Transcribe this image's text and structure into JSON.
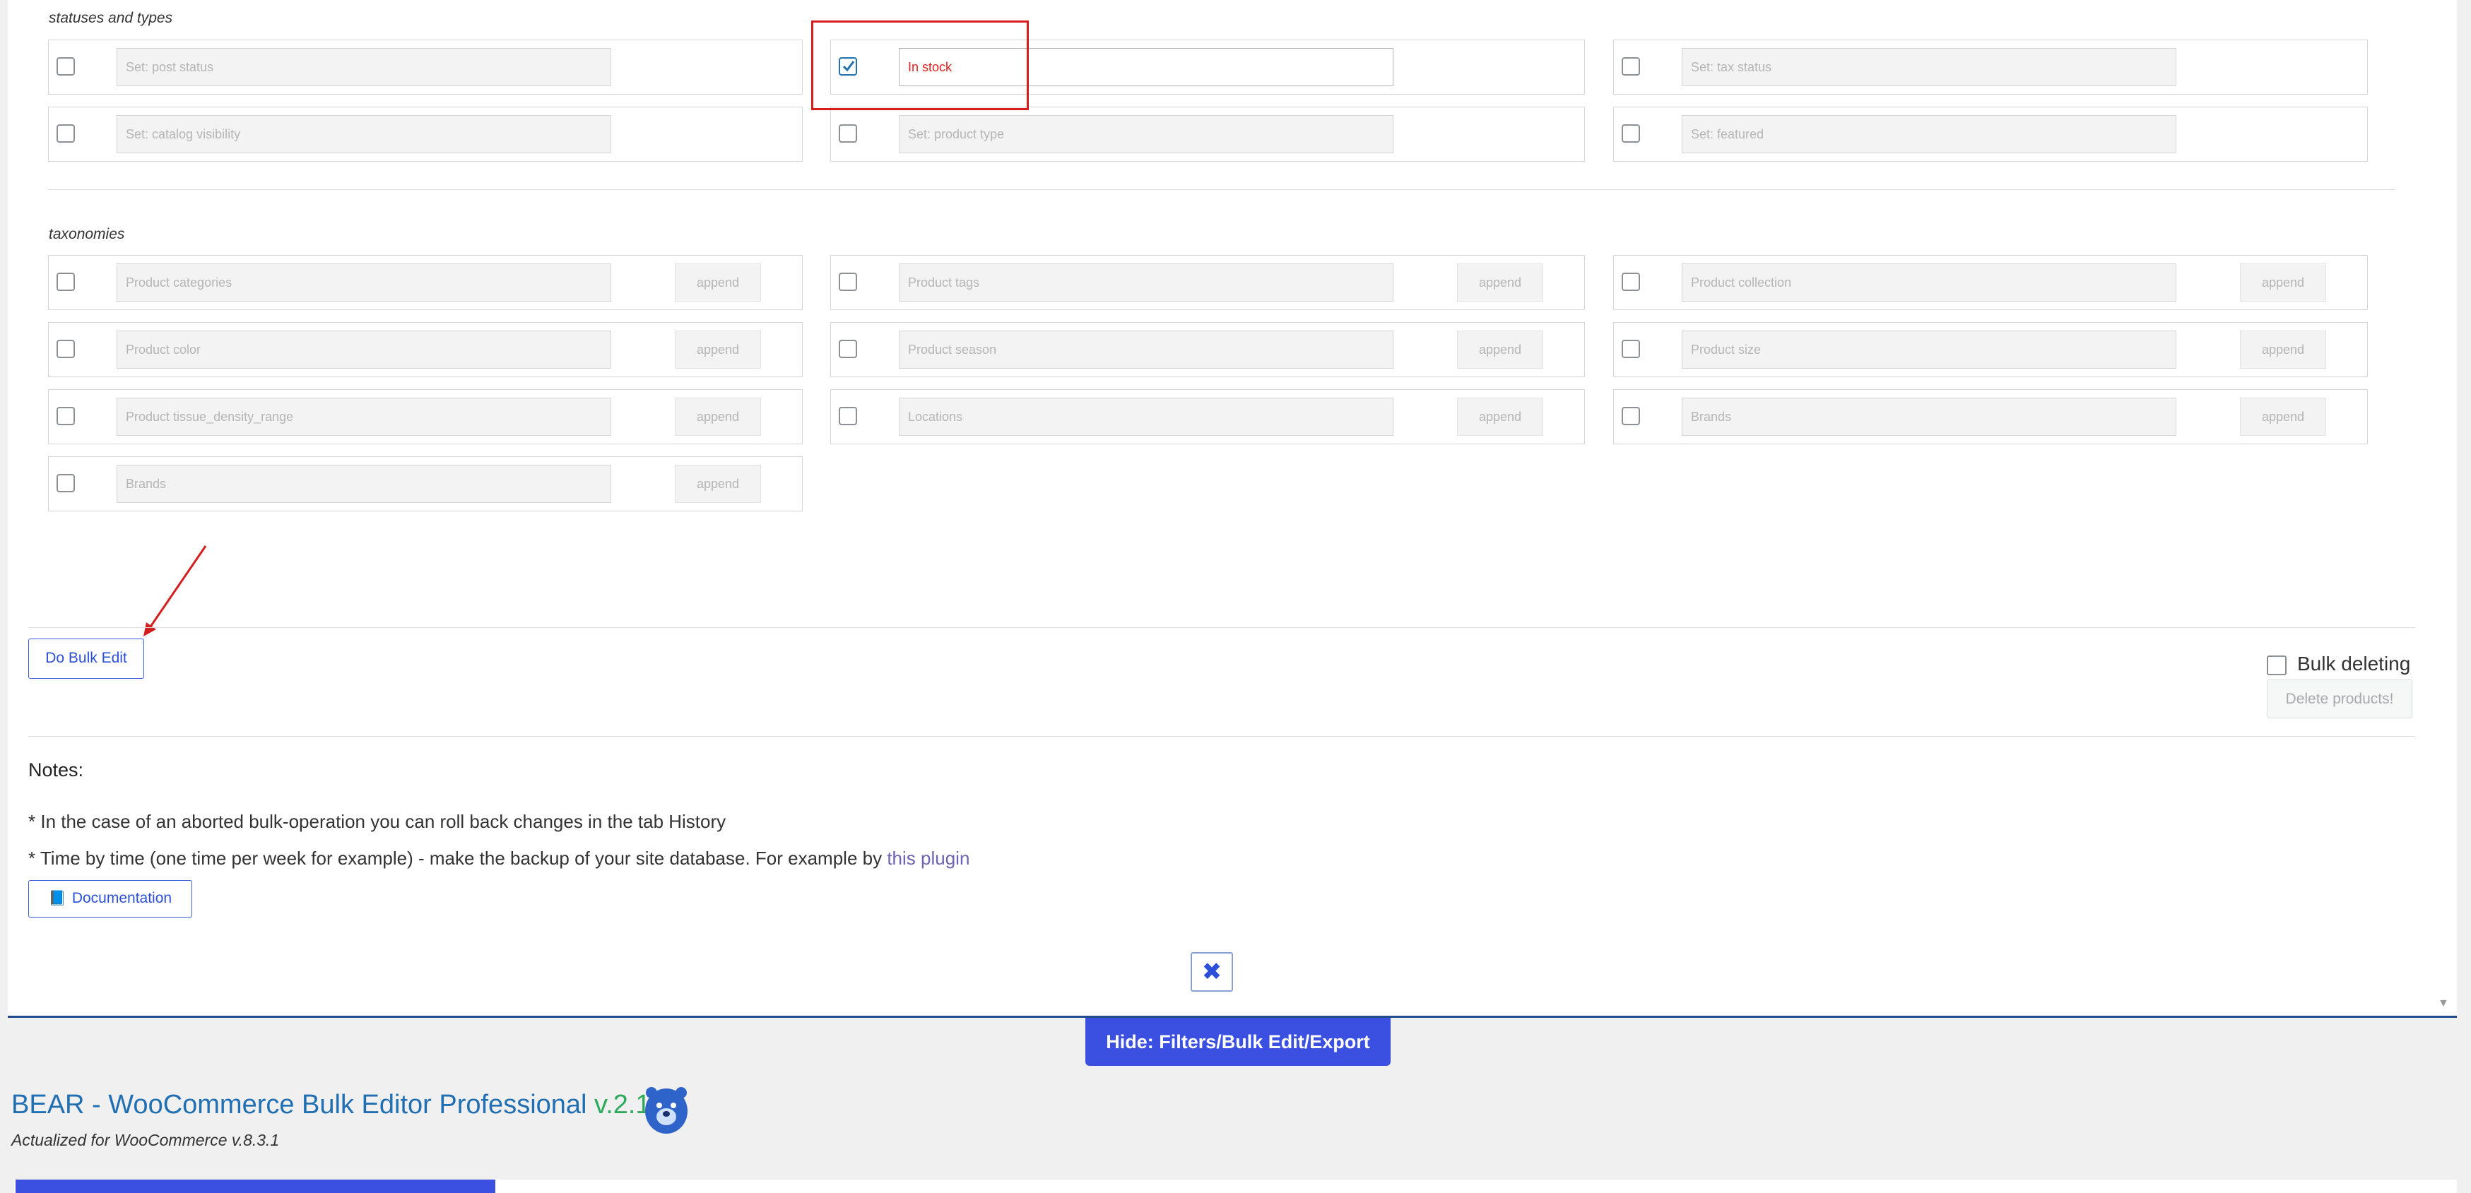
{
  "sections": {
    "statuses_title": "statuses and types",
    "taxonomies_title": "taxonomies"
  },
  "statuses": [
    {
      "placeholder": "Set: post status",
      "checked": false
    },
    {
      "value": "In stock",
      "checked": true
    },
    {
      "placeholder": "Set: tax status",
      "checked": false
    },
    {
      "placeholder": "Set: catalog visibility",
      "checked": false
    },
    {
      "placeholder": "Set: product type",
      "checked": false
    },
    {
      "placeholder": "Set: featured",
      "checked": false
    }
  ],
  "taxonomies": [
    {
      "placeholder": "Product categories",
      "mode": "append"
    },
    {
      "placeholder": "Product tags",
      "mode": "append"
    },
    {
      "placeholder": "Product collection",
      "mode": "append"
    },
    {
      "placeholder": "Product color",
      "mode": "append"
    },
    {
      "placeholder": "Product season",
      "mode": "append"
    },
    {
      "placeholder": "Product size",
      "mode": "append"
    },
    {
      "placeholder": "Product tissue_density_range",
      "mode": "append"
    },
    {
      "placeholder": "Locations",
      "mode": "append"
    },
    {
      "placeholder": "Brands",
      "mode": "append"
    },
    {
      "placeholder": "Brands",
      "mode": "append"
    }
  ],
  "actions": {
    "do_bulk_edit": "Do Bulk Edit",
    "bulk_deleting_label": "Bulk deleting",
    "delete_products": "Delete products!",
    "close_symbol": "✖",
    "hide_panel": "Hide: Filters/Bulk Edit/Export"
  },
  "notes": {
    "title": "Notes:",
    "line1": "* In the case of an aborted bulk-operation you can roll back changes in the tab History",
    "line2_prefix": "* Time by time (one time per week for example) - make the backup of your site database. For example by ",
    "line2_link": "this plugin",
    "documentation": "Documentation"
  },
  "app": {
    "title": "BEAR - WooCommerce Bulk Editor Professional",
    "version": "v.2.1.4",
    "actualized": "Actualized for WooCommerce v.8.3.1"
  },
  "colors": {
    "accent": "#3b50e0",
    "link": "#1f6fb2",
    "version": "#2eaa5c",
    "annotation_red": "#d41f1f"
  },
  "icons": [
    "checkmark-icon",
    "book-icon",
    "close-icon",
    "bear-logo-icon",
    "scroll-down-icon",
    "annotation-arrow"
  ]
}
